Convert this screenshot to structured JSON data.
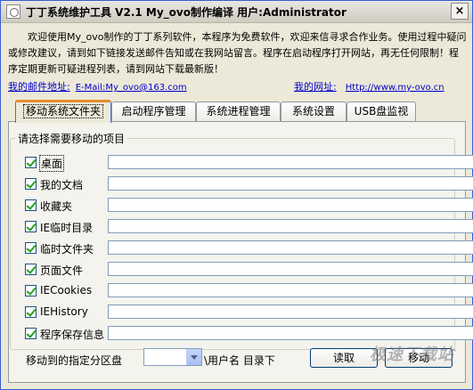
{
  "window": {
    "title": "丁丁系统维护工具 V2.1 My_ovo制作编译 用户:Administrator",
    "close_label": "×"
  },
  "intro": {
    "text": "欢迎使用My_ovo制作的丁丁系列软件，本程序为免费软件，欢迎来信寻求合作业务。使用过程中疑问或修改建议，请到如下链接发送邮件告知或在我网站留言。程序在启动程序打开网站，再无任何限制！程序定期更新可疑进程列表，请到网站下载最新版！"
  },
  "links": {
    "email_label": "我的邮件地址:",
    "email_value": "E-Mail:My_ovo@163.com",
    "site_label": "我的网址:",
    "site_value": "Http://www.my-ovo.cn"
  },
  "tabs": [
    {
      "label": "移动系统文件夹",
      "active": true
    },
    {
      "label": "启动程序管理",
      "active": false
    },
    {
      "label": "系统进程管理",
      "active": false
    },
    {
      "label": "系统设置",
      "active": false
    },
    {
      "label": "USB盘监视",
      "active": false
    }
  ],
  "group": {
    "title": "请选择需要移动的项目"
  },
  "items": [
    {
      "label": "桌面",
      "checked": true,
      "path": ""
    },
    {
      "label": "我的文档",
      "checked": true,
      "path": ""
    },
    {
      "label": "收藏夹",
      "checked": true,
      "path": ""
    },
    {
      "label": "IE临时目录",
      "checked": true,
      "path": ""
    },
    {
      "label": "临时文件夹",
      "checked": true,
      "path": ""
    },
    {
      "label": "页面文件",
      "checked": true,
      "path": ""
    },
    {
      "label": "IECookies",
      "checked": true,
      "path": ""
    },
    {
      "label": "IEHistory",
      "checked": true,
      "path": ""
    },
    {
      "label": "程序保存信息",
      "checked": true,
      "path": ""
    }
  ],
  "bottom": {
    "target_label": "移动到的指定分区盘",
    "drive_value": "",
    "suffix_label": "\\用户名 目录下",
    "read_button": "读取",
    "move_button": "移动"
  },
  "watermark": {
    "text": "极速下载站"
  },
  "colors": {
    "window_bg": "#ece9d8",
    "tab_accent": "#e68b2c",
    "link": "#0000cc",
    "check": "#21a121"
  }
}
